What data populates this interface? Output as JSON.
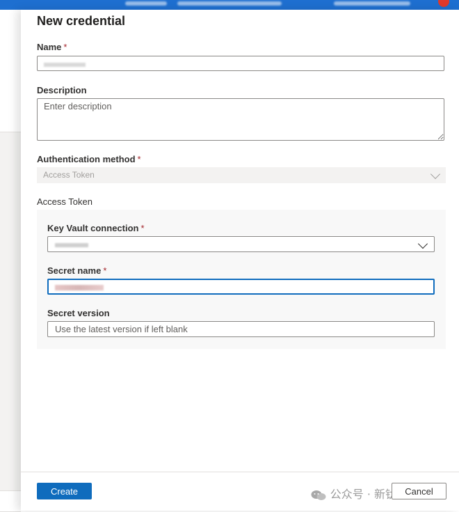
{
  "panel": {
    "title": "New credential"
  },
  "name_field": {
    "label": "Name",
    "required_marker": "*"
  },
  "description_field": {
    "label": "Description",
    "placeholder": "Enter description"
  },
  "auth_method": {
    "label": "Authentication method",
    "required_marker": "*",
    "selected": "Access Token"
  },
  "access_token_section": {
    "heading": "Access Token",
    "key_vault": {
      "label": "Key Vault connection",
      "required_marker": "*"
    },
    "secret_name": {
      "label": "Secret name",
      "required_marker": "*"
    },
    "secret_version": {
      "label": "Secret version",
      "placeholder": "Use the latest version if left blank"
    }
  },
  "footer": {
    "create_label": "Create",
    "cancel_label": "Cancel"
  },
  "watermark": {
    "text": "公众号 · 新钛云服"
  },
  "colors": {
    "accent": "#0f6cbd",
    "required": "#a4262c",
    "disabled_bg": "#f3f2f1"
  }
}
